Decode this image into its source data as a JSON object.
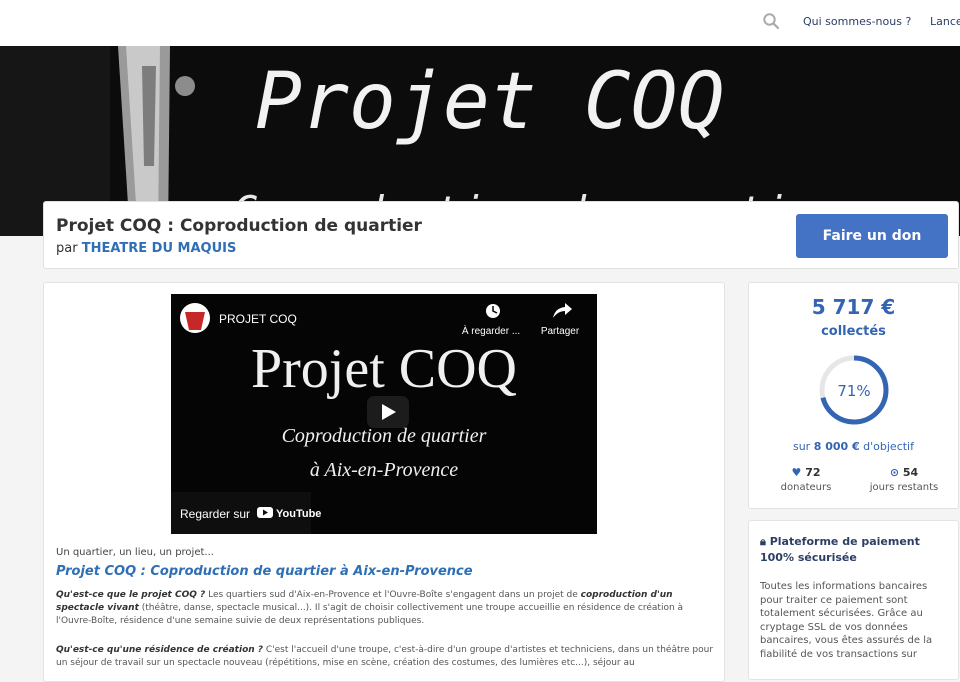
{
  "topbar": {
    "search_icon": "search-icon",
    "nav": [
      "Qui sommes-nous ?",
      "Lance"
    ]
  },
  "banner": {
    "title": "Projet COQ",
    "subtitle": "Coproduction de quartier"
  },
  "project": {
    "title": "Projet COQ : Coproduction de quartier",
    "by_prefix": "par",
    "organizer": "THEATRE DU MAQUIS",
    "donate_label": "Faire un don"
  },
  "video": {
    "channel": "PROJET COQ",
    "watch_later": "À regarder ...",
    "share": "Partager",
    "title_line1": "Projet COQ",
    "title_line2": "Coproduction de quartier",
    "title_line3": "à Aix-en-Provence",
    "watch_on": "Regarder sur",
    "youtube": "YouTube"
  },
  "content": {
    "intro": "Un quartier, un lieu, un projet...",
    "heading": "Projet COQ : Coproduction de quartier à Aix-en-Provence",
    "q1": "Qu'est-ce que le projet COQ ?",
    "p1a": " Les quartiers sud d'Aix-en-Provence et l'Ouvre-Boîte s'engagent dans un projet de ",
    "p1b": "coproduction d'un spectacle vivant",
    "p1c": " (théâtre, danse, spectacle musical...). Il s'agit de choisir collectivement une troupe accueillie en résidence de création à l'Ouvre-Boîte, résidence d'une semaine suivie de deux représentations publiques.",
    "q2": "Qu'est-ce qu'une résidence de création ?",
    "p2": " C'est l'accueil d'une troupe, c'est-à-dire d'un groupe d'artistes et techniciens, dans un théâtre pour un séjour de travail sur un spectacle nouveau (répétitions, mise en scène, création des costumes, des lumières etc...), séjour au"
  },
  "stats": {
    "amount": "5 717 €",
    "collected_label": "collectés",
    "percent": 71,
    "percent_label": "71%",
    "goal_prefix": "sur",
    "goal_amount": "8 000 €",
    "goal_suffix": "d'objectif",
    "donors_value": "72",
    "donors_label": "donateurs",
    "days_value": "54",
    "days_label": "jours restants",
    "accent_color": "#3465b4"
  },
  "secure": {
    "title": "Plateforme de paiement 100% sécurisée",
    "text": "Toutes les informations bancaires pour traiter ce paiement sont totalement sécurisées. Grâce au cryptage SSL de vos données bancaires, vous êtes assurés de la fiabilité de vos transactions sur"
  }
}
